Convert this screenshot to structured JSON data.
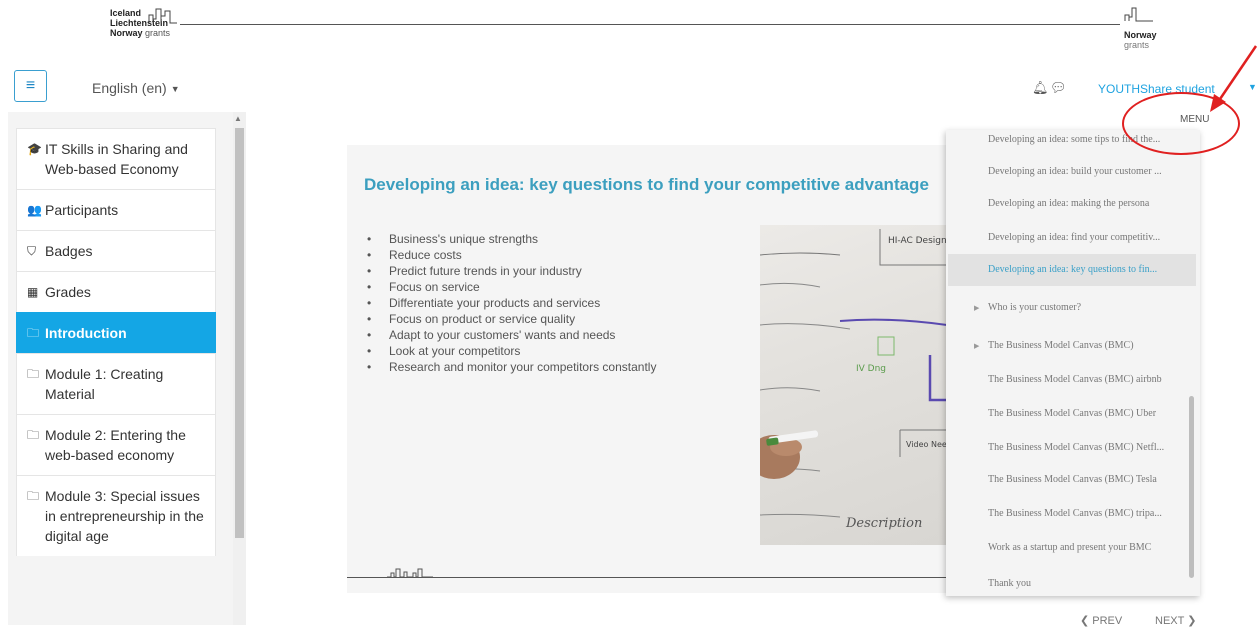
{
  "banner": {
    "left_logo": [
      "Iceland",
      "Liechtenstein",
      "Norway"
    ],
    "left_logo_suffix": "grants",
    "right_logo": "Norway",
    "right_logo_sub": "grants"
  },
  "navbar": {
    "language": "English (en)",
    "username": "YOUTHShare student"
  },
  "sidebar": {
    "items": [
      {
        "icon": "graduation-cap-icon",
        "glyph": "🎓",
        "label": "IT Skills in Sharing and Web-based Economy"
      },
      {
        "icon": "users-icon",
        "glyph": "👥",
        "label": "Participants"
      },
      {
        "icon": "shield-icon",
        "glyph": "⛉",
        "label": "Badges"
      },
      {
        "icon": "table-icon",
        "glyph": "▦",
        "label": "Grades"
      },
      {
        "icon": "folder-icon",
        "glyph": "🗀",
        "label": "Introduction",
        "active": true
      },
      {
        "icon": "folder-icon",
        "glyph": "🗀",
        "label": "Module 1: Creating Material"
      },
      {
        "icon": "folder-icon",
        "glyph": "🗀",
        "label": "Module 2: Entering the web-based economy"
      },
      {
        "icon": "folder-icon",
        "glyph": "🗀",
        "label": "Module 3: Special issues in entrepreneurship in the digital age"
      }
    ]
  },
  "slide": {
    "title": "Developing an idea: key questions to find your competitive advantage",
    "bullets": [
      "Business's unique strengths",
      "Reduce costs",
      "Predict future trends in your industry",
      "Focus on service",
      "Differentiate your products and services",
      "Focus on product or service quality",
      "Adapt to your customers' wants and needs",
      "Look at your competitors",
      "Research and monitor your competitors constantly"
    ],
    "whiteboard_text": [
      "HI-AC Design",
      "IV Dng",
      "Video Needs",
      "Description"
    ]
  },
  "menu": {
    "label": "MENU",
    "items": [
      {
        "label": "Developing an idea: some tips to find the..."
      },
      {
        "label": "Developing an idea: build your customer ..."
      },
      {
        "label": "Developing an idea: making the persona"
      },
      {
        "label": "Developing an idea: find your competitiv..."
      },
      {
        "label": "Developing an idea: key questions to fin...",
        "active": true
      },
      {
        "label": "Who is your customer?",
        "expandable": true
      },
      {
        "label": "The Business Model Canvas (BMC)",
        "expandable": true
      },
      {
        "label": "The Business Model Canvas (BMC) airbnb"
      },
      {
        "label": "The Business Model Canvas (BMC) Uber"
      },
      {
        "label": "The Business Model Canvas (BMC) Netfl..."
      },
      {
        "label": "The Business Model Canvas (BMC) Tesla"
      },
      {
        "label": "The Business Model Canvas (BMC) tripa..."
      },
      {
        "label": "Work as a startup and present your BMC"
      },
      {
        "label": "Thank you"
      }
    ]
  },
  "footer_nav": {
    "prev": "PREV",
    "next": "NEXT"
  },
  "colors": {
    "accent": "#14a6e5",
    "title": "#3c9fbf",
    "annotation": "#e02020"
  }
}
